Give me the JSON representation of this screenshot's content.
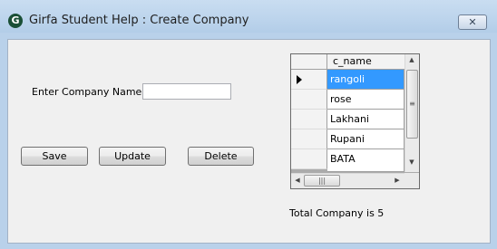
{
  "window": {
    "title": "Girfa Student Help : Create Company",
    "app_icon_letter": "G",
    "close_symbol": "✕"
  },
  "form": {
    "company_label": "Enter Company Name :",
    "company_value": "",
    "buttons": {
      "save": "Save",
      "update": "Update",
      "delete": "Delete"
    }
  },
  "grid": {
    "column_header": "c_name",
    "rows": [
      "rangoli",
      "rose",
      "Lakhani",
      "Rupani",
      "BATA"
    ],
    "selected_row": 0
  },
  "footer": {
    "total_text": "Total Company is 5"
  },
  "colors": {
    "selection": "#3399ff",
    "titlebar": "#bcd4ec"
  }
}
